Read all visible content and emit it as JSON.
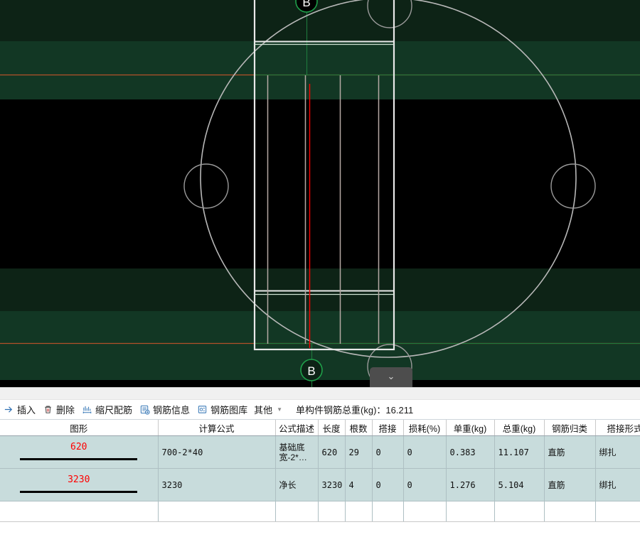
{
  "canvas": {
    "label_top": "B",
    "label_bottom": "B",
    "dropdown_glyph": "⌄",
    "colors": {
      "background": "#000000",
      "band_dark_green": "#0d2316",
      "band_green": "#123724",
      "axis_line": "#b4512a",
      "geometry_line": "#b8b8b8",
      "centerline": "#ff0000",
      "grid_green": "#1e7a3c",
      "label_green": "#1fa04a"
    }
  },
  "toolbar": {
    "items": [
      {
        "label": "插入",
        "icon": "insert-icon"
      },
      {
        "label": "删除",
        "icon": "trash-icon"
      },
      {
        "label": "缩尺配筋",
        "icon": "scale-rebar-icon"
      },
      {
        "label": "钢筋信息",
        "icon": "rebar-info-icon"
      },
      {
        "label": "钢筋图库",
        "icon": "rebar-library-icon"
      },
      {
        "label": "其他",
        "icon": "chevron-down-icon"
      }
    ],
    "total_label": "单构件钢筋总重(kg)：16.211"
  },
  "table": {
    "headers": [
      "图形",
      "计算公式",
      "公式描述",
      "长度",
      "根数",
      "搭接",
      "损耗(%)",
      "单重(kg)",
      "总重(kg)",
      "钢筋归类",
      "搭接形式"
    ],
    "rows": [
      {
        "shape_value": "620",
        "formula": "700-2*40",
        "description": "基础底宽-2*…",
        "length": "620",
        "count": "29",
        "lap": "0",
        "loss": "0",
        "unit_weight": "0.383",
        "total_weight": "11.107",
        "category": "直筋",
        "lap_type": "绑扎"
      },
      {
        "shape_value": "3230",
        "formula": "3230",
        "description": "净长",
        "length": "3230",
        "count": "4",
        "lap": "0",
        "loss": "0",
        "unit_weight": "1.276",
        "total_weight": "5.104",
        "category": "直筋",
        "lap_type": "绑扎"
      }
    ]
  }
}
